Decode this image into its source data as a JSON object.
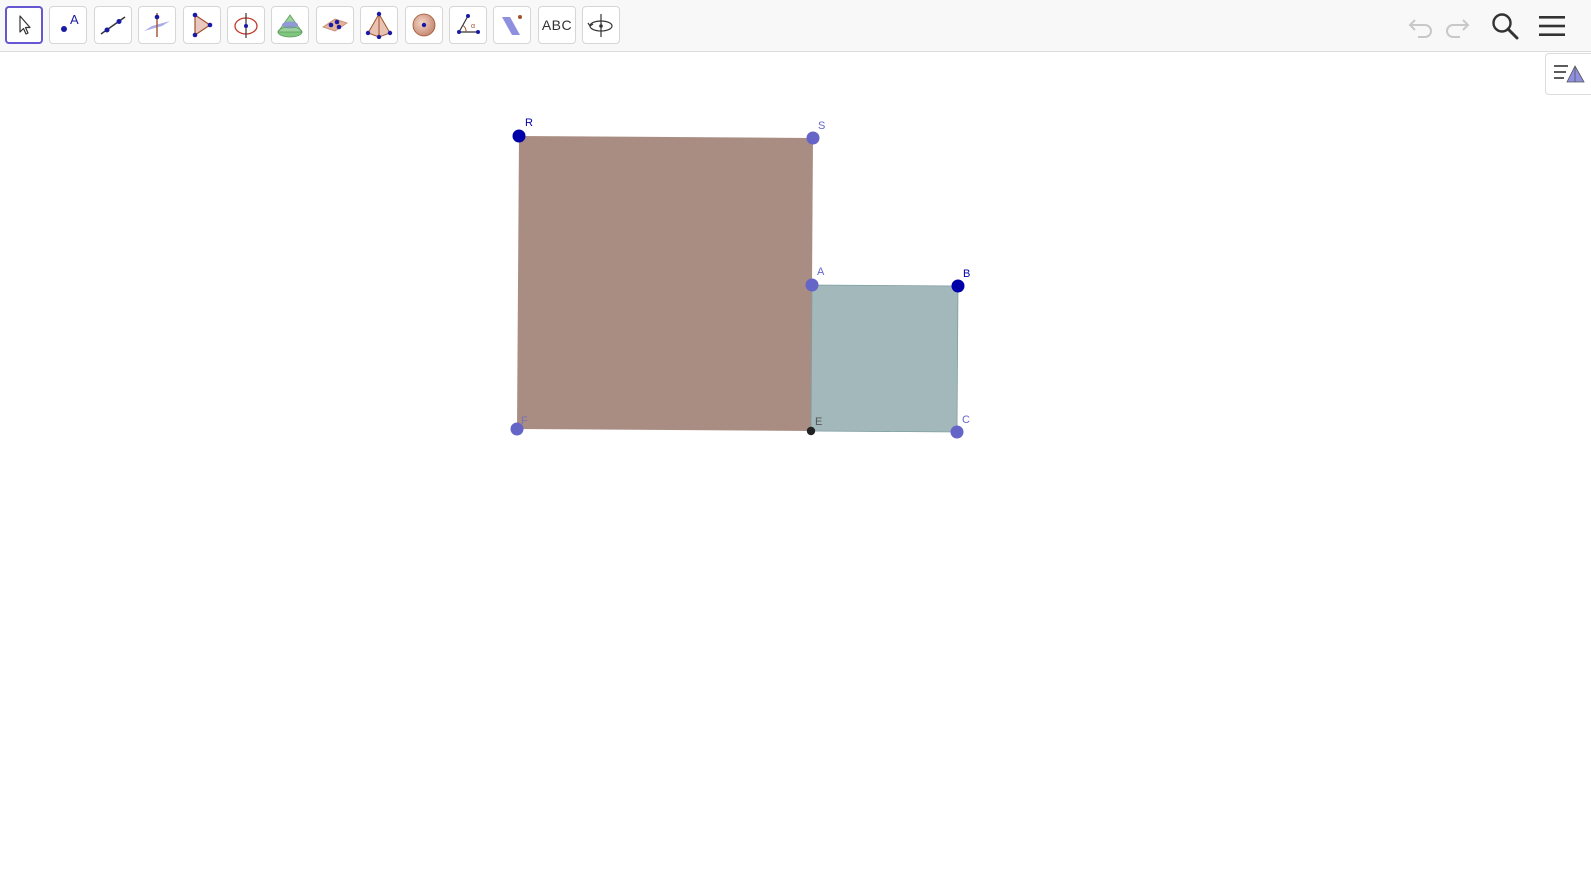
{
  "toolbar": {
    "tools": [
      {
        "name": "move-tool",
        "icon": "cursor-arrow-icon",
        "selected": true
      },
      {
        "name": "point-tool",
        "icon": "point-icon",
        "label": "A"
      },
      {
        "name": "line-tool",
        "icon": "line-icon"
      },
      {
        "name": "perpendicular-tool",
        "icon": "perpendicular-plane-icon"
      },
      {
        "name": "polygon-tool",
        "icon": "polygon-icon"
      },
      {
        "name": "circle-axis-tool",
        "icon": "circle-axis-icon"
      },
      {
        "name": "intersect-surfaces-tool",
        "icon": "cone-icon"
      },
      {
        "name": "plane-three-points-tool",
        "icon": "plane-points-icon"
      },
      {
        "name": "pyramid-tool",
        "icon": "pyramid-icon"
      },
      {
        "name": "sphere-tool",
        "icon": "sphere-icon"
      },
      {
        "name": "angle-tool",
        "icon": "angle-icon"
      },
      {
        "name": "reflect-plane-tool",
        "icon": "reflect-plane-icon"
      },
      {
        "name": "text-tool",
        "icon": "text-icon",
        "label": "ABC"
      },
      {
        "name": "rotate-view-tool",
        "icon": "rotate-view-icon"
      }
    ]
  },
  "colors": {
    "brown_polygon": "#a98d82",
    "teal_polygon": "#a3b8bb",
    "point_dark": "#0000a8",
    "point_light": "#6565c8",
    "point_black": "#222222",
    "selected_border": "#6557d2"
  },
  "points": {
    "R": {
      "label": "R"
    },
    "S": {
      "label": "S"
    },
    "A": {
      "label": "A"
    },
    "B": {
      "label": "B"
    },
    "C": {
      "label": "C"
    },
    "E": {
      "label": "E"
    },
    "F": {
      "label": "F"
    }
  }
}
